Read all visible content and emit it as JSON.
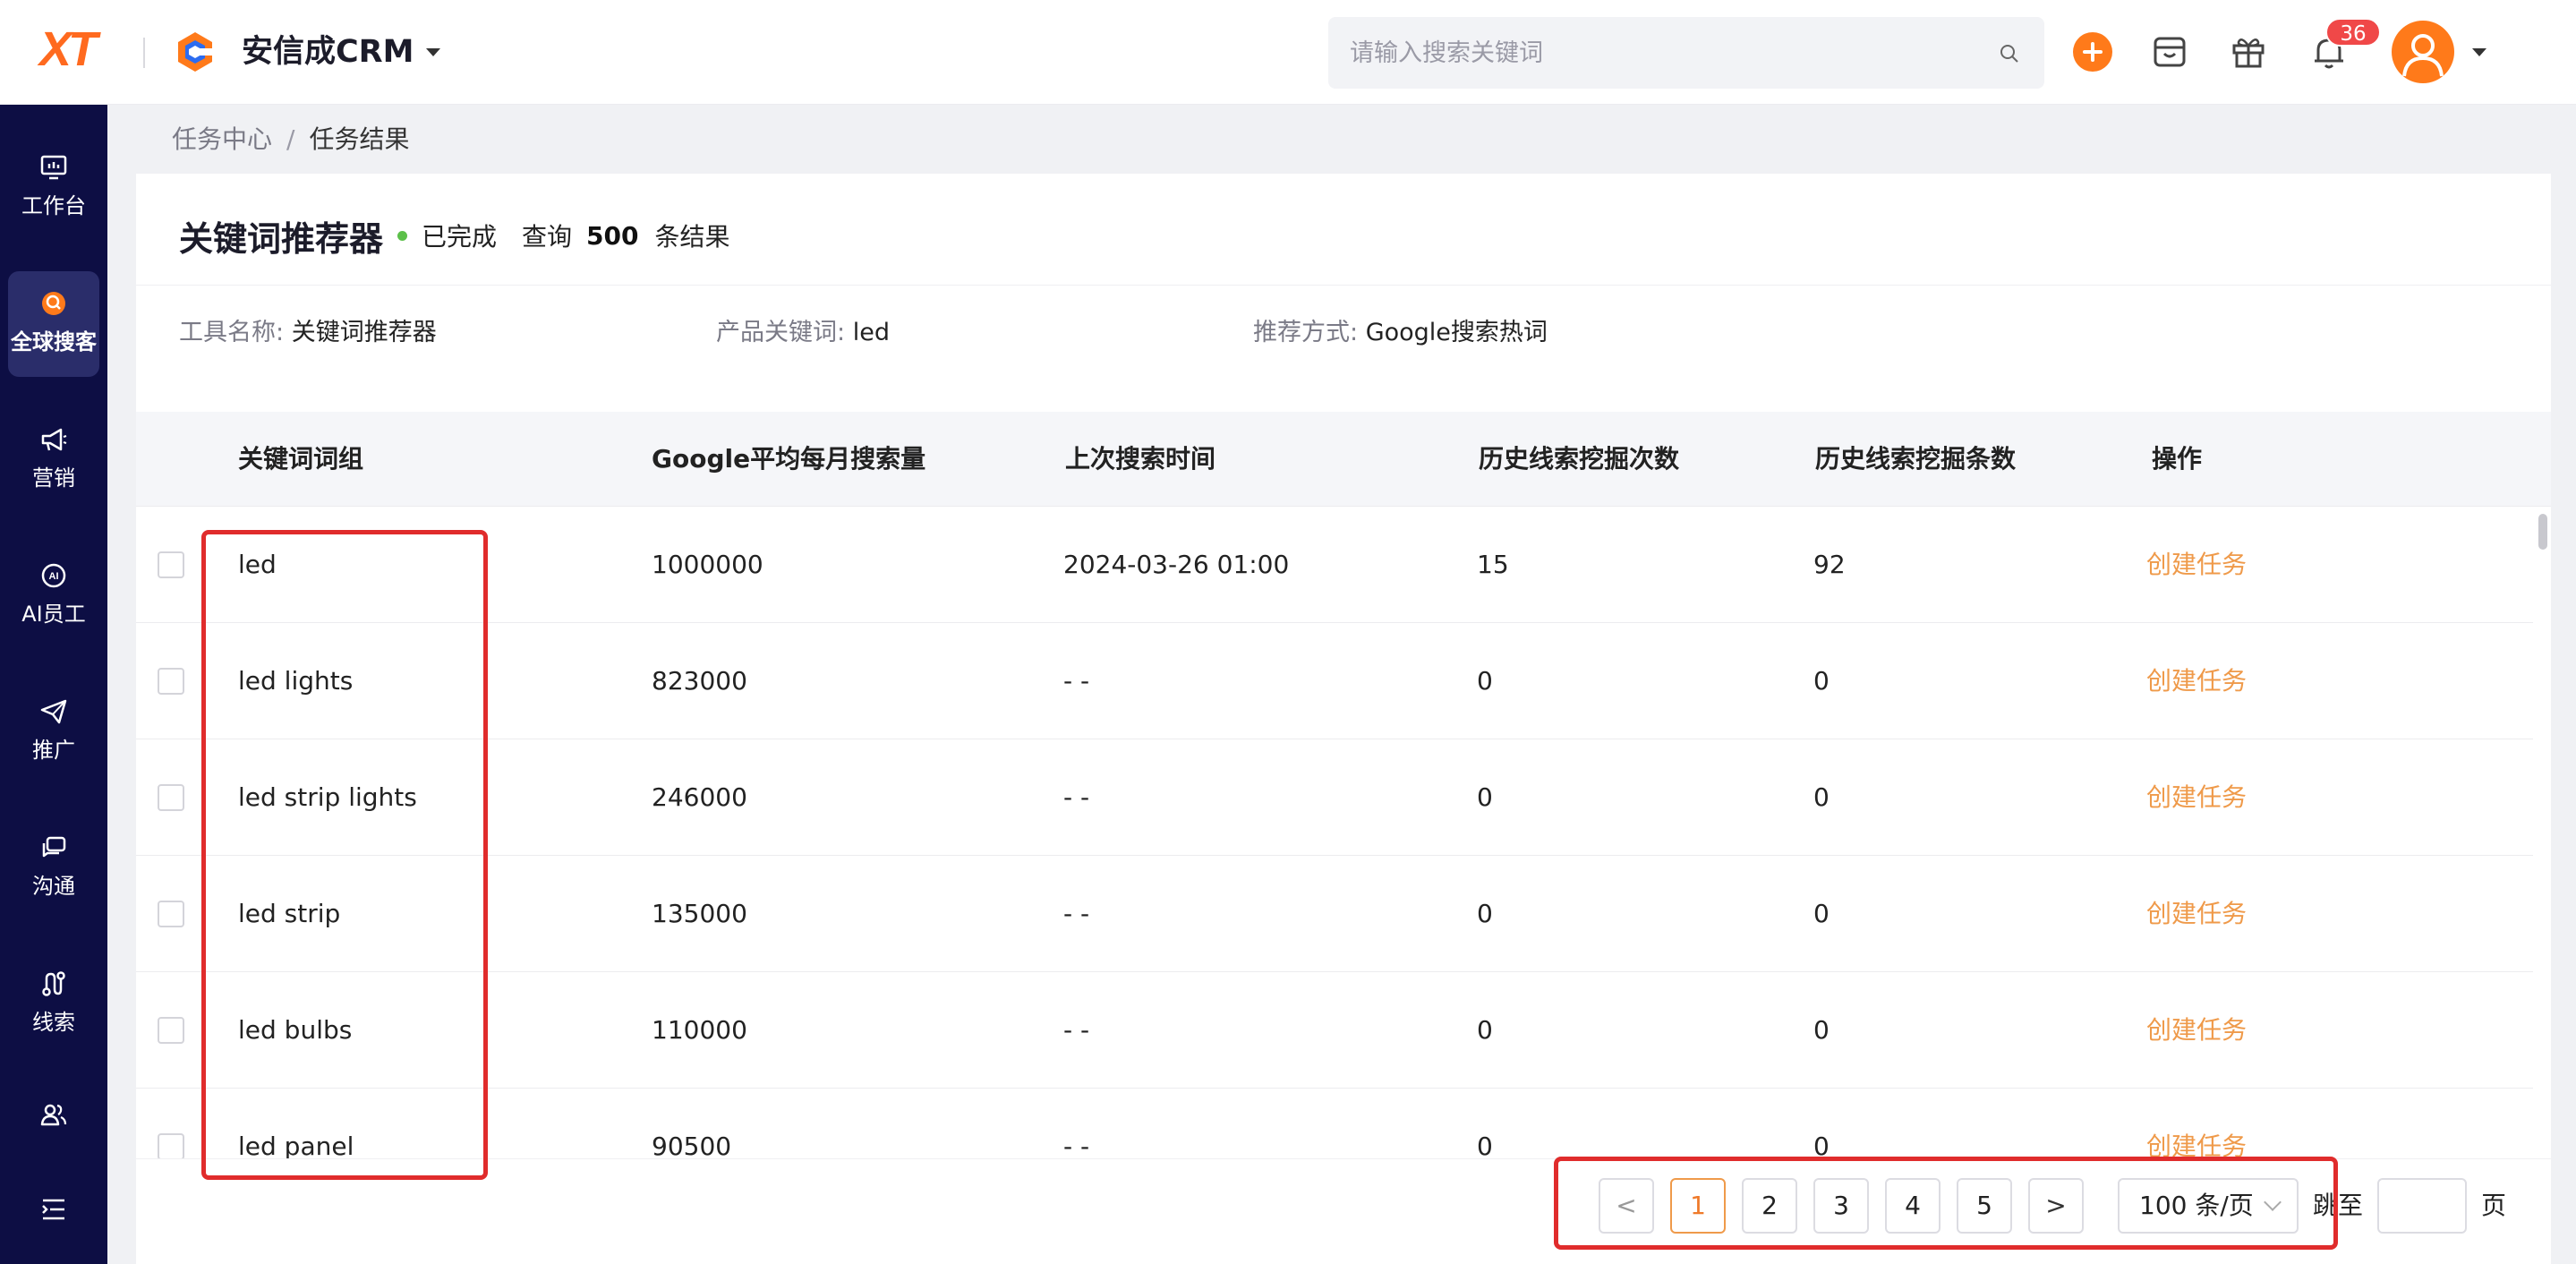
{
  "header": {
    "logo_text": "XT",
    "brand_name": "安信成CRM",
    "search_placeholder": "请输入搜索关键词",
    "notification_count": "36",
    "accent_color": "#ff7a1a"
  },
  "sidebar": {
    "items": [
      {
        "label": "工作台",
        "icon": "monitor-icon"
      },
      {
        "label": "全球搜客",
        "icon": "search-user-icon",
        "active": true
      },
      {
        "label": "营销",
        "icon": "megaphone-icon"
      },
      {
        "label": "AI员工",
        "icon": "ai-icon"
      },
      {
        "label": "推广",
        "icon": "paper-plane-icon"
      },
      {
        "label": "沟通",
        "icon": "chat-icon"
      },
      {
        "label": "线索",
        "icon": "route-icon"
      },
      {
        "label": "",
        "icon": "users-icon"
      },
      {
        "label": "",
        "icon": "menu-icon"
      }
    ]
  },
  "breadcrumb": {
    "parent": "任务中心",
    "separator": "/",
    "current": "任务结果"
  },
  "summary": {
    "title": "关键词推荐器",
    "status": "已完成",
    "query_label": "查询",
    "query_count": "500",
    "query_suffix": "条结果"
  },
  "info": {
    "tool_label": "工具名称:",
    "tool_value": "关键词推荐器",
    "keyword_label": "产品关键词:",
    "keyword_value": "led",
    "method_label": "推荐方式:",
    "method_value": "Google搜索热词"
  },
  "table": {
    "columns": [
      "关键词词组",
      "Google平均每月搜索量",
      "上次搜索时间",
      "历史线索挖掘次数",
      "历史线索挖掘条数",
      "操作"
    ],
    "action_label": "创建任务",
    "rows": [
      {
        "keyword": "led",
        "volume": "1000000",
        "last_search": "2024-03-26 01:00",
        "mining_count": "15",
        "mining_items": "92"
      },
      {
        "keyword": "led lights",
        "volume": "823000",
        "last_search": "- -",
        "mining_count": "0",
        "mining_items": "0"
      },
      {
        "keyword": "led strip lights",
        "volume": "246000",
        "last_search": "- -",
        "mining_count": "0",
        "mining_items": "0"
      },
      {
        "keyword": "led strip",
        "volume": "135000",
        "last_search": "- -",
        "mining_count": "0",
        "mining_items": "0"
      },
      {
        "keyword": "led bulbs",
        "volume": "110000",
        "last_search": "- -",
        "mining_count": "0",
        "mining_items": "0"
      },
      {
        "keyword": "led panel",
        "volume": "90500",
        "last_search": "- -",
        "mining_count": "0",
        "mining_items": "0"
      }
    ]
  },
  "pagination": {
    "prev": "<",
    "next": ">",
    "pages": [
      "1",
      "2",
      "3",
      "4",
      "5"
    ],
    "current_page": "1",
    "page_size": "100 条/页",
    "jump_label": "跳至",
    "jump_suffix": "页"
  }
}
